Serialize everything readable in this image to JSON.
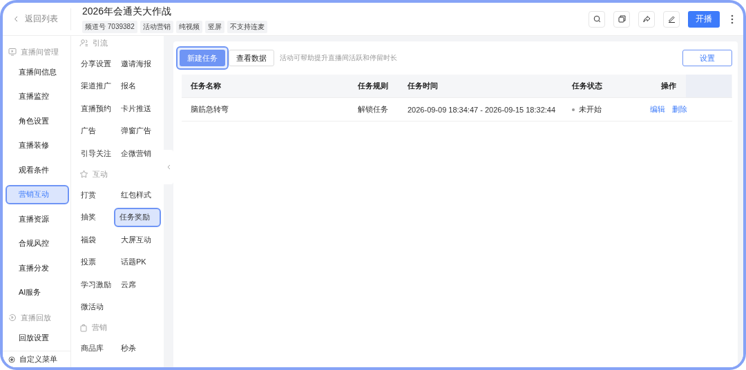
{
  "header": {
    "back_label": "返回列表",
    "title": "2026年会通关大作战",
    "tags": [
      "频道号 7039382",
      "活动营销",
      "纯视频",
      "竖屏",
      "不支持连麦"
    ],
    "start_button": "开播"
  },
  "sidebar": {
    "sections": [
      {
        "label": "直播间管理",
        "items": [
          {
            "label": "直播间信息",
            "selected": false
          },
          {
            "label": "直播监控",
            "selected": false
          },
          {
            "label": "角色设置",
            "selected": false
          },
          {
            "label": "直播装修",
            "selected": false
          },
          {
            "label": "观看条件",
            "selected": false
          },
          {
            "label": "营销互动",
            "selected": true
          },
          {
            "label": "直播资源",
            "selected": false
          },
          {
            "label": "合规风控",
            "selected": false
          },
          {
            "label": "直播分发",
            "selected": false
          },
          {
            "label": "AI服务",
            "selected": false
          }
        ]
      },
      {
        "label": "直播回放",
        "items": [
          {
            "label": "回放设置",
            "selected": false
          }
        ]
      }
    ],
    "footer": "自定义菜单"
  },
  "submenu": {
    "groups": [
      {
        "label": "引流",
        "items": [
          {
            "label": "分享设置",
            "selected": false
          },
          {
            "label": "邀请海报",
            "selected": false
          },
          {
            "label": "渠道推广",
            "selected": false
          },
          {
            "label": "报名",
            "selected": false
          },
          {
            "label": "直播预约",
            "selected": false
          },
          {
            "label": "卡片推送",
            "selected": false
          },
          {
            "label": "广告",
            "selected": false
          },
          {
            "label": "弹窗广告",
            "selected": false
          },
          {
            "label": "引导关注",
            "selected": false
          },
          {
            "label": "企微营销",
            "selected": false
          }
        ]
      },
      {
        "label": "互动",
        "items": [
          {
            "label": "打赏",
            "selected": false
          },
          {
            "label": "红包样式",
            "selected": false
          },
          {
            "label": "抽奖",
            "selected": false
          },
          {
            "label": "任务奖励",
            "selected": true
          },
          {
            "label": "福袋",
            "selected": false
          },
          {
            "label": "大屏互动",
            "selected": false
          },
          {
            "label": "投票",
            "selected": false
          },
          {
            "label": "话题PK",
            "selected": false
          },
          {
            "label": "学习激励",
            "selected": false
          },
          {
            "label": "云席",
            "selected": false
          },
          {
            "label": "微活动",
            "selected": false
          }
        ]
      },
      {
        "label": "营销",
        "items": [
          {
            "label": "商品库",
            "selected": false
          },
          {
            "label": "秒杀",
            "selected": false
          }
        ]
      }
    ]
  },
  "content": {
    "new_button": {
      "label": "新建任务",
      "highlighted": true
    },
    "data_button": "查看数据",
    "hint": "活动可帮助提升直播间活跃和停留时长",
    "settings_button": "设置",
    "table": {
      "columns": [
        "任务名称",
        "任务规则",
        "任务时间",
        "任务状态",
        "操作"
      ],
      "rows": [
        {
          "name": "脑筋急转弯",
          "rule": "解锁任务",
          "time": "2026-09-09 18:34:47 - 2026-09-15 18:32:44",
          "status": "未开始",
          "actions": [
            "编辑",
            "删除"
          ]
        }
      ]
    }
  }
}
